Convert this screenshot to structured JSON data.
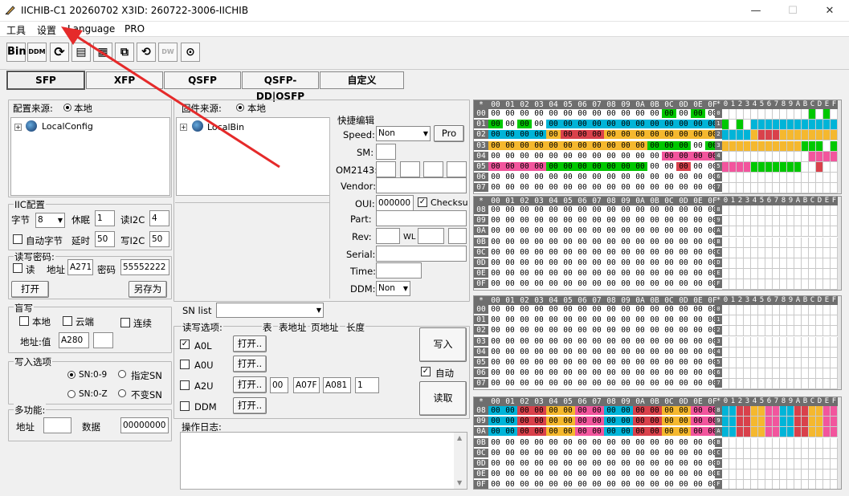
{
  "window": {
    "title": "IICHIB-C1 20260702  X3ID: 260722-3006-IICHIB",
    "min": "—",
    "max": "☐",
    "close": "✕"
  },
  "menu": [
    "工具",
    "设置",
    "Language",
    "PRO"
  ],
  "toolbar": [
    "Bin",
    "DDM",
    "⟳",
    "▤",
    "▦",
    "⧉",
    "⟲",
    "DW",
    "⊙"
  ],
  "tabs": [
    "SFP",
    "XFP",
    "QSFP",
    "QSFP-DD|OSFP",
    "自定义"
  ],
  "config": {
    "source_label": "配置来源:",
    "source_value": "本地",
    "tree_item": "LocalConfig"
  },
  "firmware": {
    "source_label": "固件来源:",
    "source_value": "本地",
    "tree_item": "LocalBin"
  },
  "iic": {
    "title": "IIC配置",
    "byte_label": "字节",
    "byte_value": "8",
    "sleep_label": "休眠",
    "sleep_value": "1",
    "read_label": "读I2C",
    "read_value": "4",
    "autobyte_label": "自动字节",
    "delay_label": "延时",
    "delay_value": "50",
    "write_label": "写I2C",
    "write_value": "50"
  },
  "rwpass": {
    "title": "读写密码:",
    "read_label": "读",
    "addr_label": "地址",
    "addr_value": "A271",
    "pass_label": "密码",
    "pass_value": "55552222",
    "open_btn": "打开",
    "saveas_btn": "另存为"
  },
  "blind": {
    "title": "盲写",
    "local_label": "本地",
    "cloud_label": "云端",
    "cont_label": "连续",
    "addr_label": "地址:值",
    "addr_value": "A280",
    "val_value": ""
  },
  "writeopt": {
    "title": "写入选项",
    "opt1": "SN:0-9",
    "opt2": "指定SN",
    "opt3": "SN:0-Z",
    "opt4": "不变SN"
  },
  "multi": {
    "title": "多功能:",
    "addr_label": "地址",
    "data_label": "数据",
    "data_value": "00000000"
  },
  "quick": {
    "title": "快捷编辑",
    "speed_label": "Speed:",
    "speed_value": "Non",
    "pro_btn": "Pro",
    "sm_label": "SM:",
    "om_label": "OM2143:",
    "vendor_label": "Vendor:",
    "oui_label": "OUI:",
    "oui_value": "000000",
    "checksum_label": "Checksum",
    "part_label": "Part:",
    "rev_label": "Rev:",
    "wl_label": "WL",
    "serial_label": "Serial:",
    "time_label": "Time:",
    "ddm_label": "DDM:",
    "ddm_value": "Non"
  },
  "snlist": {
    "label": "SN list"
  },
  "rw": {
    "title": "读写选项:",
    "col_table": "表",
    "col_taddr": "表地址",
    "col_page": "页地址",
    "col_len": "长度",
    "items": [
      "A0L",
      "A0U",
      "A2U",
      "DDM"
    ],
    "open_btn": "打开..",
    "table_value": "00",
    "taddr_value": "A07F",
    "page_value": "A081",
    "len_value": "1",
    "write_btn": "写入",
    "auto_label": "自动",
    "read_btn": "读取"
  },
  "log": {
    "title": "操作日志:"
  },
  "hex": {
    "colors": {
      "g": "#00c800",
      "c": "#00b4d8",
      "y": "#f5b82e",
      "r": "#d9414b",
      "p": "#f2559d",
      "w": "#ffffff"
    },
    "cols": [
      "00",
      "01",
      "02",
      "03",
      "04",
      "05",
      "06",
      "07",
      "08",
      "09",
      "0A",
      "0B",
      "0C",
      "0D",
      "0E",
      "0F"
    ],
    "mcols": [
      "0",
      "1",
      "2",
      "3",
      "4",
      "5",
      "6",
      "7",
      "8",
      "9",
      "A",
      "B",
      "C",
      "D",
      "E",
      "F"
    ],
    "panes": [
      {
        "rows": [
          "00",
          "01",
          "02",
          "03",
          "04",
          "05",
          "06",
          "07"
        ],
        "colors": [
          "wwwwwwwwwwwwgwgw",
          "gwgwcccccccccccc",
          "ccccyrrryyyyyyyy",
          "yyyyyyyyyyygggwg",
          "wwwwwwwwwwwwpppp",
          "ppppgggggggwwrww",
          "wwwwwwwwwwwwwwww",
          "wwwwwwwwwwwwwwww"
        ]
      },
      {
        "rows": [
          "08",
          "09",
          "0A",
          "0B",
          "0C",
          "0D",
          "0E",
          "0F"
        ],
        "colors": [
          "wwwwwwwwwwwwwwww",
          "wwwwwwwwwwwwwwww",
          "wwwwwwwwwwwwwwww",
          "wwwwwwwwwwwwwwww",
          "wwwwwwwwwwwwwwww",
          "wwwwwwwwwwwwwwww",
          "wwwwwwwwwwwwwwww",
          "wwwwwwwwwwwwwwww"
        ]
      },
      {
        "rows": [
          "00",
          "01",
          "02",
          "03",
          "04",
          "05",
          "06",
          "07"
        ],
        "colors": [
          "wwwwwwwwwwwwwwww",
          "wwwwwwwwwwwwwwww",
          "wwwwwwwwwwwwwwww",
          "wwwwwwwwwwwwwwww",
          "wwwwwwwwwwwwwwww",
          "wwwwwwwwwwwwwwww",
          "wwwwwwwwwwwwwwww",
          "wwwwwwwwwwwwwwww"
        ]
      },
      {
        "rows": [
          "08",
          "09",
          "0A",
          "0B",
          "0C",
          "0D",
          "0E",
          "0F"
        ],
        "colors": [
          "ccrryyppccrryypp",
          "ccrryyppccrryypp",
          "ccrryyppccrryypp",
          "wwwwwwwwwwwwwwww",
          "wwwwwwwwwwwwwwww",
          "wwwwwwwwwwwwwwww",
          "wwwwwwwwwwwwwwww",
          "wwwwwwwwwwwwwwww"
        ]
      }
    ]
  }
}
